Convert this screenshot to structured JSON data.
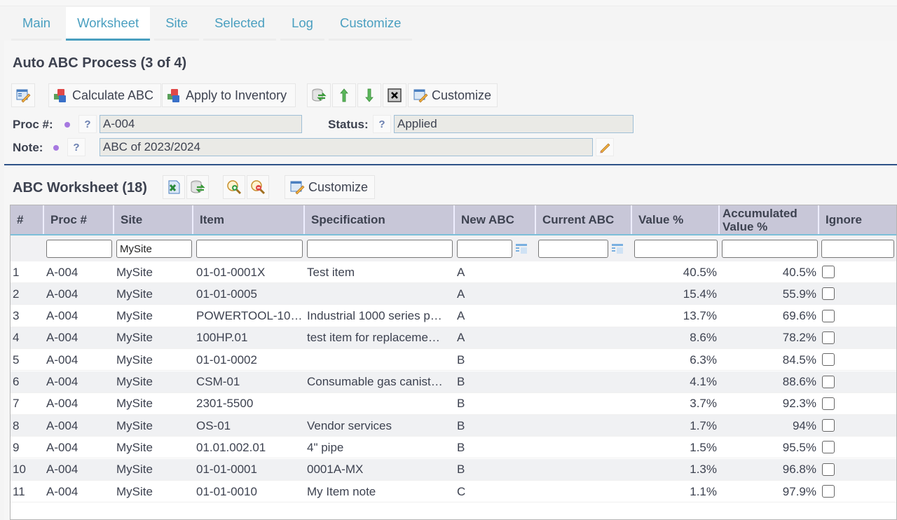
{
  "tabs": [
    {
      "label": "Main",
      "active": false
    },
    {
      "label": "Worksheet",
      "active": true
    },
    {
      "label": "Site",
      "active": false
    },
    {
      "label": "Selected",
      "active": false
    },
    {
      "label": "Log",
      "active": false
    },
    {
      "label": "Customize",
      "active": false
    }
  ],
  "process": {
    "title": "Auto ABC Process (3 of 4)",
    "toolbar": {
      "edit_icon": "form-edit-icon",
      "calculate_label": "Calculate ABC",
      "apply_label": "Apply to Inventory",
      "refresh_icon": "database-refresh-icon",
      "up_icon": "arrow-up-icon",
      "down_icon": "arrow-down-icon",
      "close_icon": "close-box-icon",
      "customize_label": "Customize"
    },
    "fields": {
      "proc_label": "Proc #:",
      "proc_value": "A-004",
      "status_label": "Status:",
      "status_value": "Applied",
      "note_label": "Note:",
      "note_value": "ABC of 2023/2024",
      "help_glyph": "?"
    }
  },
  "worksheet": {
    "title": "ABC Worksheet (18)",
    "toolbar": {
      "excel_icon": "excel-export-icon",
      "refresh_icon": "database-refresh-icon",
      "zoom_in_icon": "zoom-in-icon",
      "zoom_out_icon": "zoom-out-icon",
      "customize_label": "Customize"
    },
    "columns": [
      "#",
      "Proc #",
      "Site",
      "Item",
      "Specification",
      "New ABC",
      "Current ABC",
      "Value %",
      "Accumulated Value %",
      "Ignore"
    ],
    "filters": {
      "proc": "",
      "site": "MySite",
      "item": "",
      "specification": "",
      "new_abc": "",
      "current_abc": "",
      "value_pct": "",
      "acc_value_pct": "",
      "ignore": ""
    },
    "rows": [
      {
        "n": "1",
        "proc": "A-004",
        "site": "MySite",
        "item": "01-01-0001X",
        "spec": "Test item",
        "new_abc": "A",
        "cur_abc": "",
        "value": "40.5%",
        "acc": "40.5%",
        "ignore": false
      },
      {
        "n": "2",
        "proc": "A-004",
        "site": "MySite",
        "item": "01-01-0005",
        "spec": "",
        "new_abc": "A",
        "cur_abc": "",
        "value": "15.4%",
        "acc": "55.9%",
        "ignore": false
      },
      {
        "n": "3",
        "proc": "A-004",
        "site": "MySite",
        "item": "POWERTOOL-10…",
        "spec": "Industrial 1000 series p…",
        "new_abc": "A",
        "cur_abc": "",
        "value": "13.7%",
        "acc": "69.6%",
        "ignore": false
      },
      {
        "n": "4",
        "proc": "A-004",
        "site": "MySite",
        "item": "100HP.01",
        "spec": "test item for replaceme…",
        "new_abc": "A",
        "cur_abc": "",
        "value": "8.6%",
        "acc": "78.2%",
        "ignore": false
      },
      {
        "n": "5",
        "proc": "A-004",
        "site": "MySite",
        "item": "01-01-0002",
        "spec": "",
        "new_abc": "B",
        "cur_abc": "",
        "value": "6.3%",
        "acc": "84.5%",
        "ignore": false
      },
      {
        "n": "6",
        "proc": "A-004",
        "site": "MySite",
        "item": "CSM-01",
        "spec": "Consumable gas canist…",
        "new_abc": "B",
        "cur_abc": "",
        "value": "4.1%",
        "acc": "88.6%",
        "ignore": false
      },
      {
        "n": "7",
        "proc": "A-004",
        "site": "MySite",
        "item": "2301-5500",
        "spec": "",
        "new_abc": "B",
        "cur_abc": "",
        "value": "3.7%",
        "acc": "92.3%",
        "ignore": false
      },
      {
        "n": "8",
        "proc": "A-004",
        "site": "MySite",
        "item": "OS-01",
        "spec": "Vendor services",
        "new_abc": "B",
        "cur_abc": "",
        "value": "1.7%",
        "acc": "94%",
        "ignore": false
      },
      {
        "n": "9",
        "proc": "A-004",
        "site": "MySite",
        "item": "01.01.002.01",
        "spec": "4\" pipe",
        "new_abc": "B",
        "cur_abc": "",
        "value": "1.5%",
        "acc": "95.5%",
        "ignore": false
      },
      {
        "n": "10",
        "proc": "A-004",
        "site": "MySite",
        "item": "01-01-0001",
        "spec": "0001A-MX",
        "new_abc": "B",
        "cur_abc": "",
        "value": "1.3%",
        "acc": "96.8%",
        "ignore": false
      },
      {
        "n": "11",
        "proc": "A-004",
        "site": "MySite",
        "item": "01-01-0010",
        "spec": "My Item note",
        "new_abc": "C",
        "cur_abc": "",
        "value": "1.1%",
        "acc": "97.9%",
        "ignore": false
      }
    ]
  },
  "colors": {
    "accent": "#4a9fc0",
    "header_bg": "#c8c7d8",
    "divider": "#2e5288",
    "required_dot": "#a678e0"
  }
}
